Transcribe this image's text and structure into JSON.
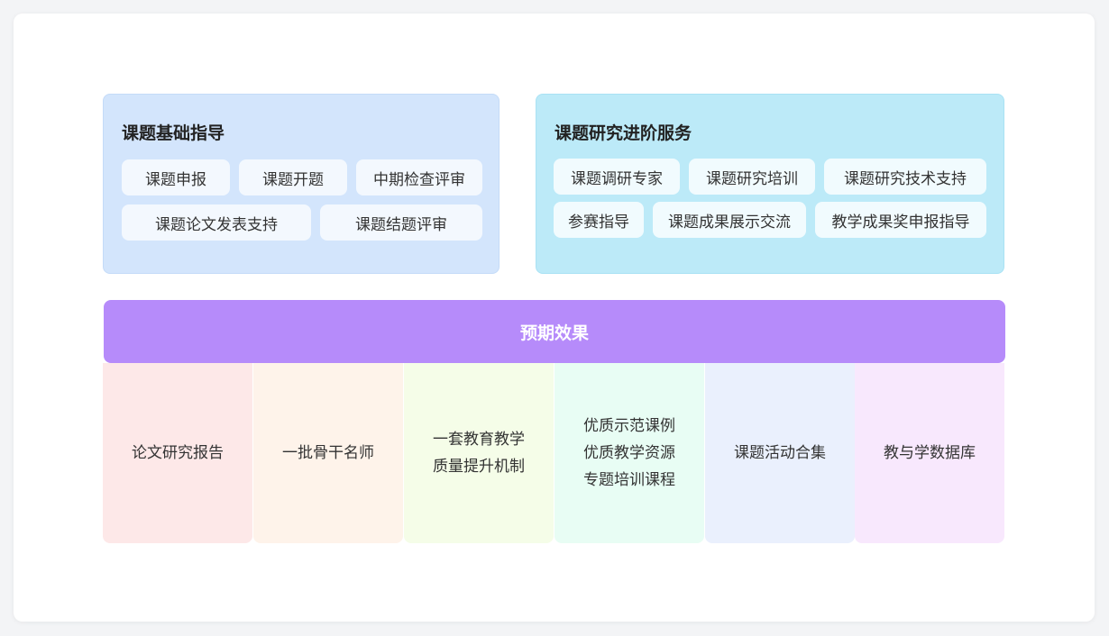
{
  "basic": {
    "title": "课题基础指导",
    "items": [
      "课题申报",
      "课题开题",
      "中期检查评审",
      "课题论文发表支持",
      "课题结题评审"
    ]
  },
  "advanced": {
    "title": "课题研究进阶服务",
    "items": [
      "课题调研专家",
      "课题研究培训",
      "课题研究技术支持",
      "参赛指导",
      "课题成果展示交流",
      "教学成果奖申报指导"
    ]
  },
  "effect": {
    "title": "预期效果",
    "outcomes": [
      {
        "lines": [
          "论文研究报告"
        ],
        "color": "#fde8e8"
      },
      {
        "lines": [
          "一批骨干名师"
        ],
        "color": "#fef3ea"
      },
      {
        "lines": [
          "一套教育教学",
          "质量提升机制"
        ],
        "color": "#f5fde8"
      },
      {
        "lines": [
          "优质示范课例",
          "优质教学资源",
          "专题培训课程"
        ],
        "color": "#e8fdf4"
      },
      {
        "lines": [
          "课题活动合集"
        ],
        "color": "#eaf0fd"
      },
      {
        "lines": [
          "教与学数据库"
        ],
        "color": "#f8e8fd"
      }
    ]
  }
}
